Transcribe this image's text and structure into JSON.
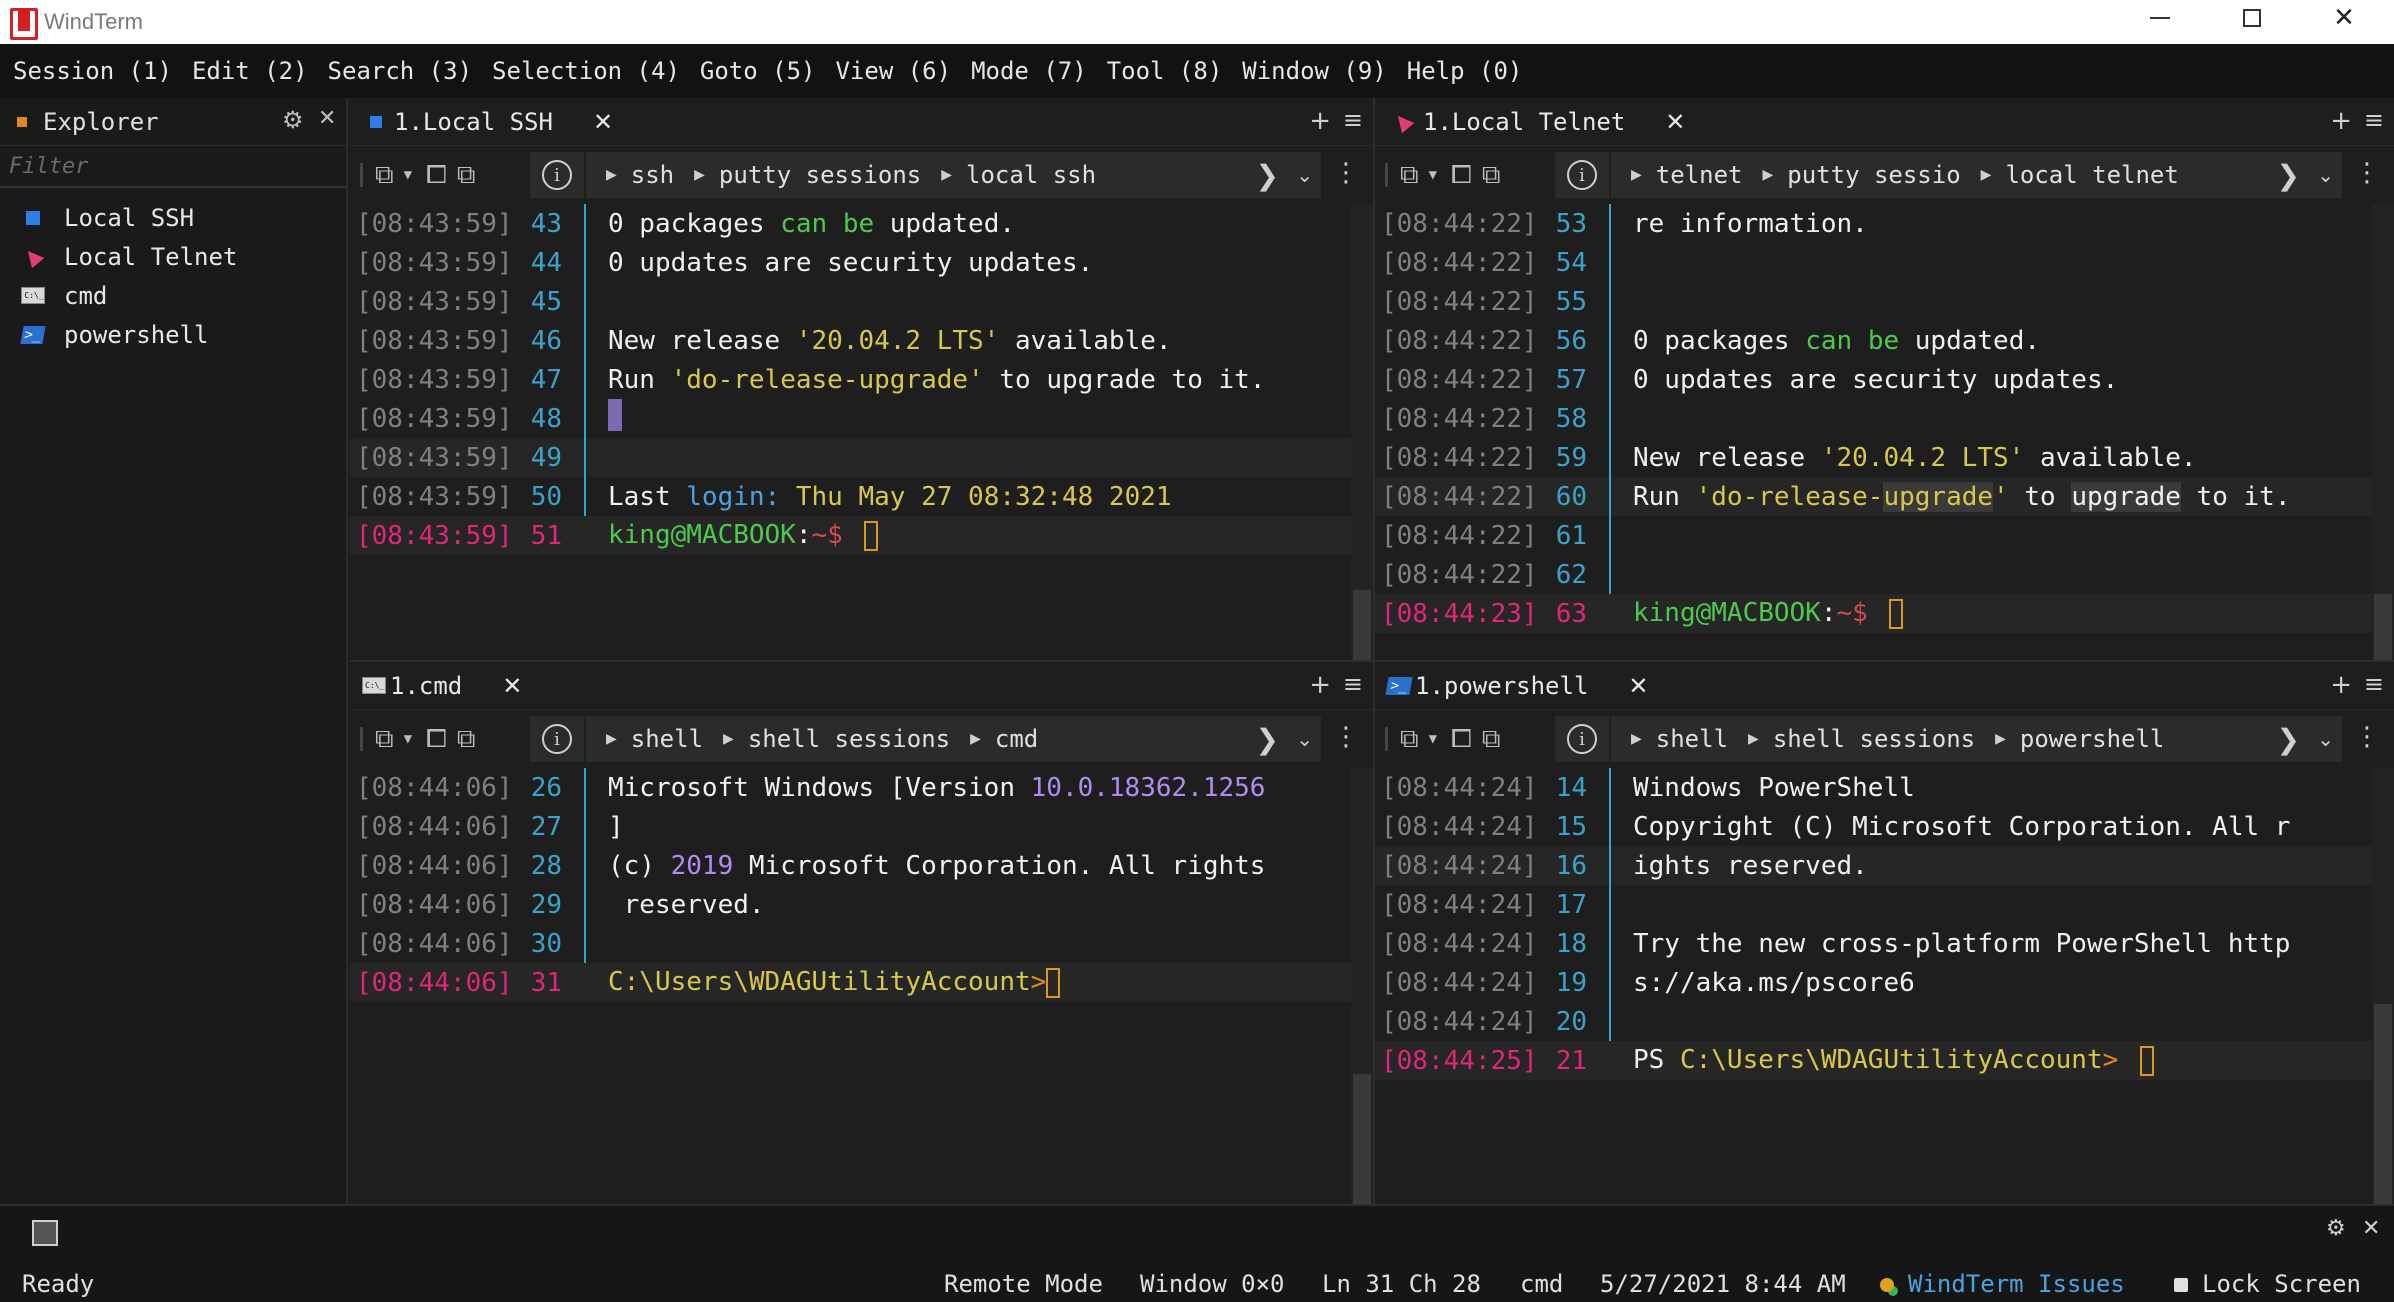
{
  "window": {
    "title": "WindTerm"
  },
  "menu": [
    "Session (1)",
    "Edit (2)",
    "Search (3)",
    "Selection (4)",
    "Goto (5)",
    "View (6)",
    "Mode (7)",
    "Tool (8)",
    "Window (9)",
    "Help (0)"
  ],
  "explorer": {
    "title": "Explorer",
    "filter_placeholder": "Filter",
    "items": [
      {
        "label": "Local SSH",
        "icon": "ssh-icon"
      },
      {
        "label": "Local Telnet",
        "icon": "telnet-icon"
      },
      {
        "label": "cmd",
        "icon": "cmd-icon"
      },
      {
        "label": "powershell",
        "icon": "powershell-icon"
      }
    ]
  },
  "panes": {
    "ssh": {
      "tab": "1.Local SSH",
      "crumbs": [
        "ssh",
        "putty sessions",
        "local ssh"
      ],
      "lines": [
        {
          "ts": "[08:43:59]",
          "n": "43",
          "text": ""
        },
        {
          "ts": "[08:43:59]",
          "n": "44",
          "text": "0 updates are security updates."
        },
        {
          "ts": "[08:43:59]",
          "n": "45",
          "text": ""
        },
        {
          "ts": "[08:43:59]",
          "n": "46",
          "text": ""
        },
        {
          "ts": "[08:43:59]",
          "n": "47",
          "text": ""
        },
        {
          "ts": "[08:43:59]",
          "n": "48",
          "text": ""
        },
        {
          "ts": "[08:43:59]",
          "n": "49",
          "text": ""
        },
        {
          "ts": "[08:43:59]",
          "n": "50",
          "text": ""
        },
        {
          "ts": "[08:43:59]",
          "n": "51",
          "text": ""
        }
      ],
      "l43": {
        "a": "0 packages ",
        "b": "can",
        "c": " ",
        "d": "be",
        "e": " updated."
      },
      "l46": {
        "a": "New release ",
        "b": "'20.04.2 LTS'",
        "c": " available."
      },
      "l47": {
        "a": "Run ",
        "b": "'do-release-upgrade'",
        "c": " to upgrade to it."
      },
      "l50": {
        "a": "Last ",
        "b": "login:",
        "c": " Thu May 27 08:32:48 2021"
      },
      "prompt": {
        "user": "king@MACBOOK",
        "colon": ":",
        "path": "~$"
      }
    },
    "telnet": {
      "tab": "1.Local Telnet",
      "crumbs": [
        "telnet",
        "putty sessio",
        "local telnet"
      ],
      "lines": [
        {
          "ts": "[08:44:22]",
          "n": "53",
          "text": "re information."
        },
        {
          "ts": "[08:44:22]",
          "n": "54",
          "text": ""
        },
        {
          "ts": "[08:44:22]",
          "n": "55",
          "text": ""
        },
        {
          "ts": "[08:44:22]",
          "n": "56",
          "text": ""
        },
        {
          "ts": "[08:44:22]",
          "n": "57",
          "text": "0 updates are security updates."
        },
        {
          "ts": "[08:44:22]",
          "n": "58",
          "text": ""
        },
        {
          "ts": "[08:44:22]",
          "n": "59",
          "text": ""
        },
        {
          "ts": "[08:44:22]",
          "n": "60",
          "text": ""
        },
        {
          "ts": "[08:44:22]",
          "n": "61",
          "text": ""
        },
        {
          "ts": "[08:44:22]",
          "n": "62",
          "text": ""
        },
        {
          "ts": "[08:44:23]",
          "n": "63",
          "text": ""
        }
      ],
      "l56": {
        "a": "0 packages ",
        "b": "can",
        "c": " ",
        "d": "be",
        "e": " updated."
      },
      "l59": {
        "a": "New release ",
        "b": "'20.04.2 LTS'",
        "c": " available."
      },
      "l60": {
        "a": "Run ",
        "b": "'do-release-",
        "c": "upgrade",
        "d": "'",
        "e": " to ",
        "f": "upgrade",
        "g": " to it."
      },
      "prompt": {
        "user": "king@MACBOOK",
        "colon": ":",
        "path": "~$"
      }
    },
    "cmd": {
      "tab": "1.cmd",
      "crumbs": [
        "shell",
        "shell sessions",
        "cmd"
      ],
      "lines": [
        {
          "ts": "[08:44:06]",
          "n": "26",
          "text": ""
        },
        {
          "ts": "[08:44:06]",
          "n": "27",
          "text": "]"
        },
        {
          "ts": "[08:44:06]",
          "n": "28",
          "text": ""
        },
        {
          "ts": "[08:44:06]",
          "n": "29",
          "text": " reserved."
        },
        {
          "ts": "[08:44:06]",
          "n": "30",
          "text": ""
        },
        {
          "ts": "[08:44:06]",
          "n": "31",
          "text": ""
        }
      ],
      "l26": {
        "a": "Microsoft Windows [Version ",
        "b": "10.0.18362.1256"
      },
      "l28": {
        "a": "(c) ",
        "b": "2019",
        "c": " Microsoft Corporation. All rights"
      },
      "prompt": {
        "path": "C:\\Users\\WDAGUtilityAccount",
        "gt": ">"
      }
    },
    "ps": {
      "tab": "1.powershell",
      "crumbs": [
        "shell",
        "shell sessions",
        "powershell"
      ],
      "lines": [
        {
          "ts": "[08:44:24]",
          "n": "14",
          "text": "Windows PowerShell"
        },
        {
          "ts": "[08:44:24]",
          "n": "15",
          "text": "Copyright (C) Microsoft Corporation. All r"
        },
        {
          "ts": "[08:44:24]",
          "n": "16",
          "text": "ights reserved."
        },
        {
          "ts": "[08:44:24]",
          "n": "17",
          "text": ""
        },
        {
          "ts": "[08:44:24]",
          "n": "18",
          "text": "Try the new cross-platform PowerShell http"
        },
        {
          "ts": "[08:44:24]",
          "n": "19",
          "text": "s://aka.ms/pscore6"
        },
        {
          "ts": "[08:44:24]",
          "n": "20",
          "text": ""
        },
        {
          "ts": "[08:44:25]",
          "n": "21",
          "text": ""
        }
      ],
      "prompt": {
        "ps": "PS ",
        "path": "C:\\Users\\WDAGUtilityAccount",
        "gt": ">"
      }
    }
  },
  "status": {
    "ready": "Ready",
    "mode": "Remote Mode",
    "window": "Window 0×0",
    "position": "Ln 31 Ch 28",
    "shell": "cmd",
    "datetime": "5/27/2021 8:44 AM",
    "issues": "WindTerm Issues",
    "lock": "Lock Screen"
  },
  "colors": {
    "accent": "#3aa3c9",
    "current_line": "#e0267a",
    "string": "#d8c84a",
    "keyword": "#4ec94e"
  }
}
